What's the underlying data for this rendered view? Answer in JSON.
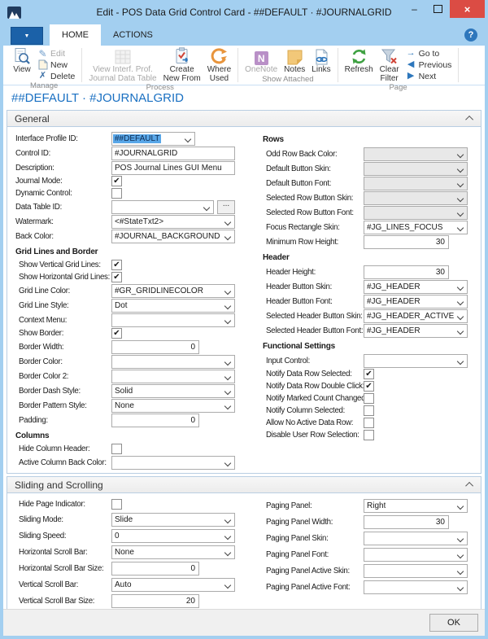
{
  "window": {
    "title": "Edit - POS Data Grid Control Card - ##DEFAULT · #JOURNALGRID"
  },
  "glyphs": {
    "check": "✔",
    "ellipsis": "...",
    "edit": "✎",
    "delete": "✗",
    "dropdown": "▼",
    "help": "?",
    "goto": "→",
    "previous": "◀",
    "next": "▶",
    "minimize": "–",
    "close": "×",
    "onenote_letter": "N"
  },
  "colors": {
    "chrome_blue": "#A3CFF0",
    "close_red": "#DB4C44",
    "appmenu_blue": "#1B61A8",
    "page_title_blue": "#1A70C2",
    "selection_blue": "#59A7E8",
    "disabled_combo_gray": "#E8E8E8"
  },
  "ribbon": {
    "tabs": [
      {
        "label": "HOME"
      },
      {
        "label": "ACTIONS"
      }
    ],
    "manage": {
      "caption": "Manage",
      "view": "View",
      "edit": "Edit",
      "new": "New",
      "delete": "Delete"
    },
    "process": {
      "caption": "Process",
      "view_interf": "View Interf. Prof.\nJournal Data Table",
      "create_new_from": "Create\nNew From",
      "where_used": "Where\nUsed"
    },
    "show_attached": {
      "caption": "Show Attached",
      "onenote": "OneNote",
      "notes": "Notes",
      "links": "Links"
    },
    "page": {
      "caption": "Page",
      "refresh": "Refresh",
      "clear_filter": "Clear\nFilter",
      "goto": "Go to",
      "previous": "Previous",
      "next": "Next"
    }
  },
  "page": {
    "title": "##DEFAULT · #JOURNALGRID"
  },
  "sections": [
    {
      "title": "General",
      "columns": [
        {
          "rows": [
            {
              "label": "Interface Profile ID:",
              "type": "combo",
              "value": "##DEFAULT",
              "selected": true,
              "size": "narrow"
            },
            {
              "label": "Control ID:",
              "type": "text",
              "value": "#JOURNALGRID"
            },
            {
              "label": "Description:",
              "type": "text",
              "value": "POS Journal Lines GUI Menu"
            },
            {
              "label": "Journal Mode:",
              "type": "checkbox",
              "checked": true
            },
            {
              "label": "Dynamic Control:",
              "type": "checkbox",
              "checked": false
            },
            {
              "label": "Data Table ID:",
              "type": "combo",
              "value": "",
              "size": "mid",
              "ellipsis": true
            },
            {
              "label": "Watermark:",
              "type": "combo",
              "value": "<#StateTxt2>"
            },
            {
              "label": "Back Color:",
              "type": "combo",
              "value": "#JOURNAL_BACKGROUND"
            },
            {
              "type": "group",
              "label": "Grid Lines and Border"
            },
            {
              "label": "Show Vertical Grid Lines:",
              "type": "checkbox",
              "checked": true,
              "indent": true
            },
            {
              "label": "Show Horizontal Grid Lines:",
              "type": "checkbox",
              "checked": true,
              "indent": true
            },
            {
              "label": "Grid Line Color:",
              "type": "combo",
              "value": "#GR_GRIDLINECOLOR",
              "indent": true
            },
            {
              "label": "Grid Line Style:",
              "type": "combo",
              "value": "Dot",
              "indent": true
            },
            {
              "label": "Context Menu:",
              "type": "combo",
              "value": "",
              "indent": true
            },
            {
              "label": "Show Border:",
              "type": "checkbox",
              "checked": true,
              "indent": true
            },
            {
              "label": "Border Width:",
              "type": "number",
              "value": "0",
              "indent": true
            },
            {
              "label": "Border Color:",
              "type": "combo",
              "value": "",
              "indent": true
            },
            {
              "label": "Border Color 2:",
              "type": "combo",
              "value": "",
              "indent": true
            },
            {
              "label": "Border Dash Style:",
              "type": "combo",
              "value": "Solid",
              "indent": true
            },
            {
              "label": "Border Pattern Style:",
              "type": "combo",
              "value": "None",
              "indent": true
            },
            {
              "label": "Padding:",
              "type": "number",
              "value": "0",
              "indent": true
            },
            {
              "type": "group",
              "label": "Columns"
            },
            {
              "label": "Hide Column Header:",
              "type": "checkbox",
              "checked": false,
              "indent": true
            },
            {
              "label": "Active Column Back Color:",
              "type": "combo",
              "value": "",
              "indent": true
            }
          ]
        },
        {
          "rows": [
            {
              "type": "group",
              "label": "Rows"
            },
            {
              "label": "Odd Row Back Color:",
              "type": "combo",
              "value": "",
              "gray": true,
              "indent": true
            },
            {
              "label": "Default Button Skin:",
              "type": "combo",
              "value": "",
              "gray": true,
              "indent": true
            },
            {
              "label": "Default Button Font:",
              "type": "combo",
              "value": "",
              "gray": true,
              "indent": true
            },
            {
              "label": "Selected Row Button Skin:",
              "type": "combo",
              "value": "",
              "gray": true,
              "indent": true
            },
            {
              "label": "Selected Row Button Font:",
              "type": "combo",
              "value": "",
              "gray": true,
              "indent": true
            },
            {
              "label": "Focus Rectangle Skin:",
              "type": "combo",
              "value": "#JG_LINES_FOCUS",
              "indent": true
            },
            {
              "label": "Minimum Row Height:",
              "type": "number",
              "value": "30",
              "indent": true
            },
            {
              "type": "group",
              "label": "Header"
            },
            {
              "label": "Header Height:",
              "type": "number",
              "value": "30",
              "indent": true
            },
            {
              "label": "Header Button Skin:",
              "type": "combo",
              "value": "#JG_HEADER",
              "indent": true
            },
            {
              "label": "Header Button Font:",
              "type": "combo",
              "value": "#JG_HEADER",
              "indent": true
            },
            {
              "label": "Selected Header Button Skin:",
              "type": "combo",
              "value": "#JG_HEADER_ACTIVE",
              "indent": true
            },
            {
              "label": "Selected Header Button Font:",
              "type": "combo",
              "value": "#JG_HEADER",
              "indent": true
            },
            {
              "type": "group",
              "label": "Functional Settings"
            },
            {
              "label": "Input Control:",
              "type": "combo",
              "value": "",
              "indent": true
            },
            {
              "label": "Notify Data Row Selected:",
              "type": "checkbox",
              "checked": true,
              "indent": true
            },
            {
              "label": "Notify Data Row Double Click:",
              "type": "checkbox",
              "checked": true,
              "indent": true
            },
            {
              "label": "Notify Marked Count Changed:",
              "type": "checkbox",
              "checked": false,
              "indent": true
            },
            {
              "label": "Notify Column Selected:",
              "type": "checkbox",
              "checked": false,
              "indent": true
            },
            {
              "label": "Allow No Active Data Row:",
              "type": "checkbox",
              "checked": false,
              "indent": true
            },
            {
              "label": "Disable User Row Selection:",
              "type": "checkbox",
              "checked": false,
              "indent": true
            }
          ]
        }
      ]
    },
    {
      "title": "Sliding and Scrolling",
      "columns": [
        {
          "rows": [
            {
              "label": "Hide Page Indicator:",
              "type": "checkbox",
              "checked": false,
              "indent": true
            },
            {
              "label": "Sliding Mode:",
              "type": "combo",
              "value": "Slide",
              "indent": true
            },
            {
              "label": "Sliding Speed:",
              "type": "combo",
              "value": "0",
              "indent": true
            },
            {
              "label": "Horizontal Scroll Bar:",
              "type": "combo",
              "value": "None",
              "indent": true
            },
            {
              "label": "Horizontal Scroll Bar Size:",
              "type": "number",
              "value": "0",
              "indent": true
            },
            {
              "label": "Vertical Scroll Bar:",
              "type": "combo",
              "value": "Auto",
              "indent": true
            },
            {
              "label": "Vertical Scroll Bar Size:",
              "type": "number",
              "value": "20",
              "indent": true
            }
          ]
        },
        {
          "rows": [
            {
              "label": "Paging Panel:",
              "type": "combo",
              "value": "Right",
              "indent": true
            },
            {
              "label": "Paging Panel Width:",
              "type": "number",
              "value": "30",
              "indent": true
            },
            {
              "label": "Paging Panel Skin:",
              "type": "combo",
              "value": "",
              "indent": true
            },
            {
              "label": "Paging Panel Font:",
              "type": "combo",
              "value": "",
              "indent": true
            },
            {
              "label": "Paging Panel Active Skin:",
              "type": "combo",
              "value": "",
              "indent": true
            },
            {
              "label": "Paging Panel Active Font:",
              "type": "combo",
              "value": "",
              "indent": true
            }
          ]
        }
      ]
    }
  ],
  "footer": {
    "ok_label": "OK"
  }
}
